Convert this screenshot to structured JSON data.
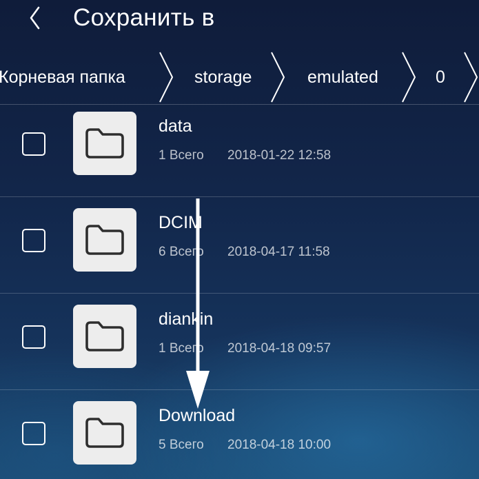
{
  "header": {
    "title": "Сохранить в",
    "back_icon": "chevron-left-icon"
  },
  "breadcrumb": {
    "items": [
      {
        "label": "Корневая папка"
      },
      {
        "label": "storage"
      },
      {
        "label": "emulated"
      },
      {
        "label": "0"
      }
    ],
    "separator_icon": "chevron-right-icon"
  },
  "files": [
    {
      "name": "data",
      "count": "1 Всего",
      "date": "2018-01-22 12:58",
      "icon": "folder-icon",
      "checked": false
    },
    {
      "name": "DCIM",
      "count": "6 Всего",
      "date": "2018-04-17 11:58",
      "icon": "folder-icon",
      "checked": false
    },
    {
      "name": "diankin",
      "count": "1 Всего",
      "date": "2018-04-18 09:57",
      "icon": "folder-icon",
      "checked": false
    },
    {
      "name": "Download",
      "count": "5 Всего",
      "date": "2018-04-18 10:00",
      "icon": "folder-icon",
      "checked": false
    }
  ],
  "overlay": {
    "icon": "down-arrow-icon"
  },
  "colors": {
    "background_top": "#0f1c3a",
    "background_bottom": "#1b4a72",
    "text": "#ffffff",
    "folder_tile": "#ededed",
    "folder_outline": "#2e2e2e"
  }
}
